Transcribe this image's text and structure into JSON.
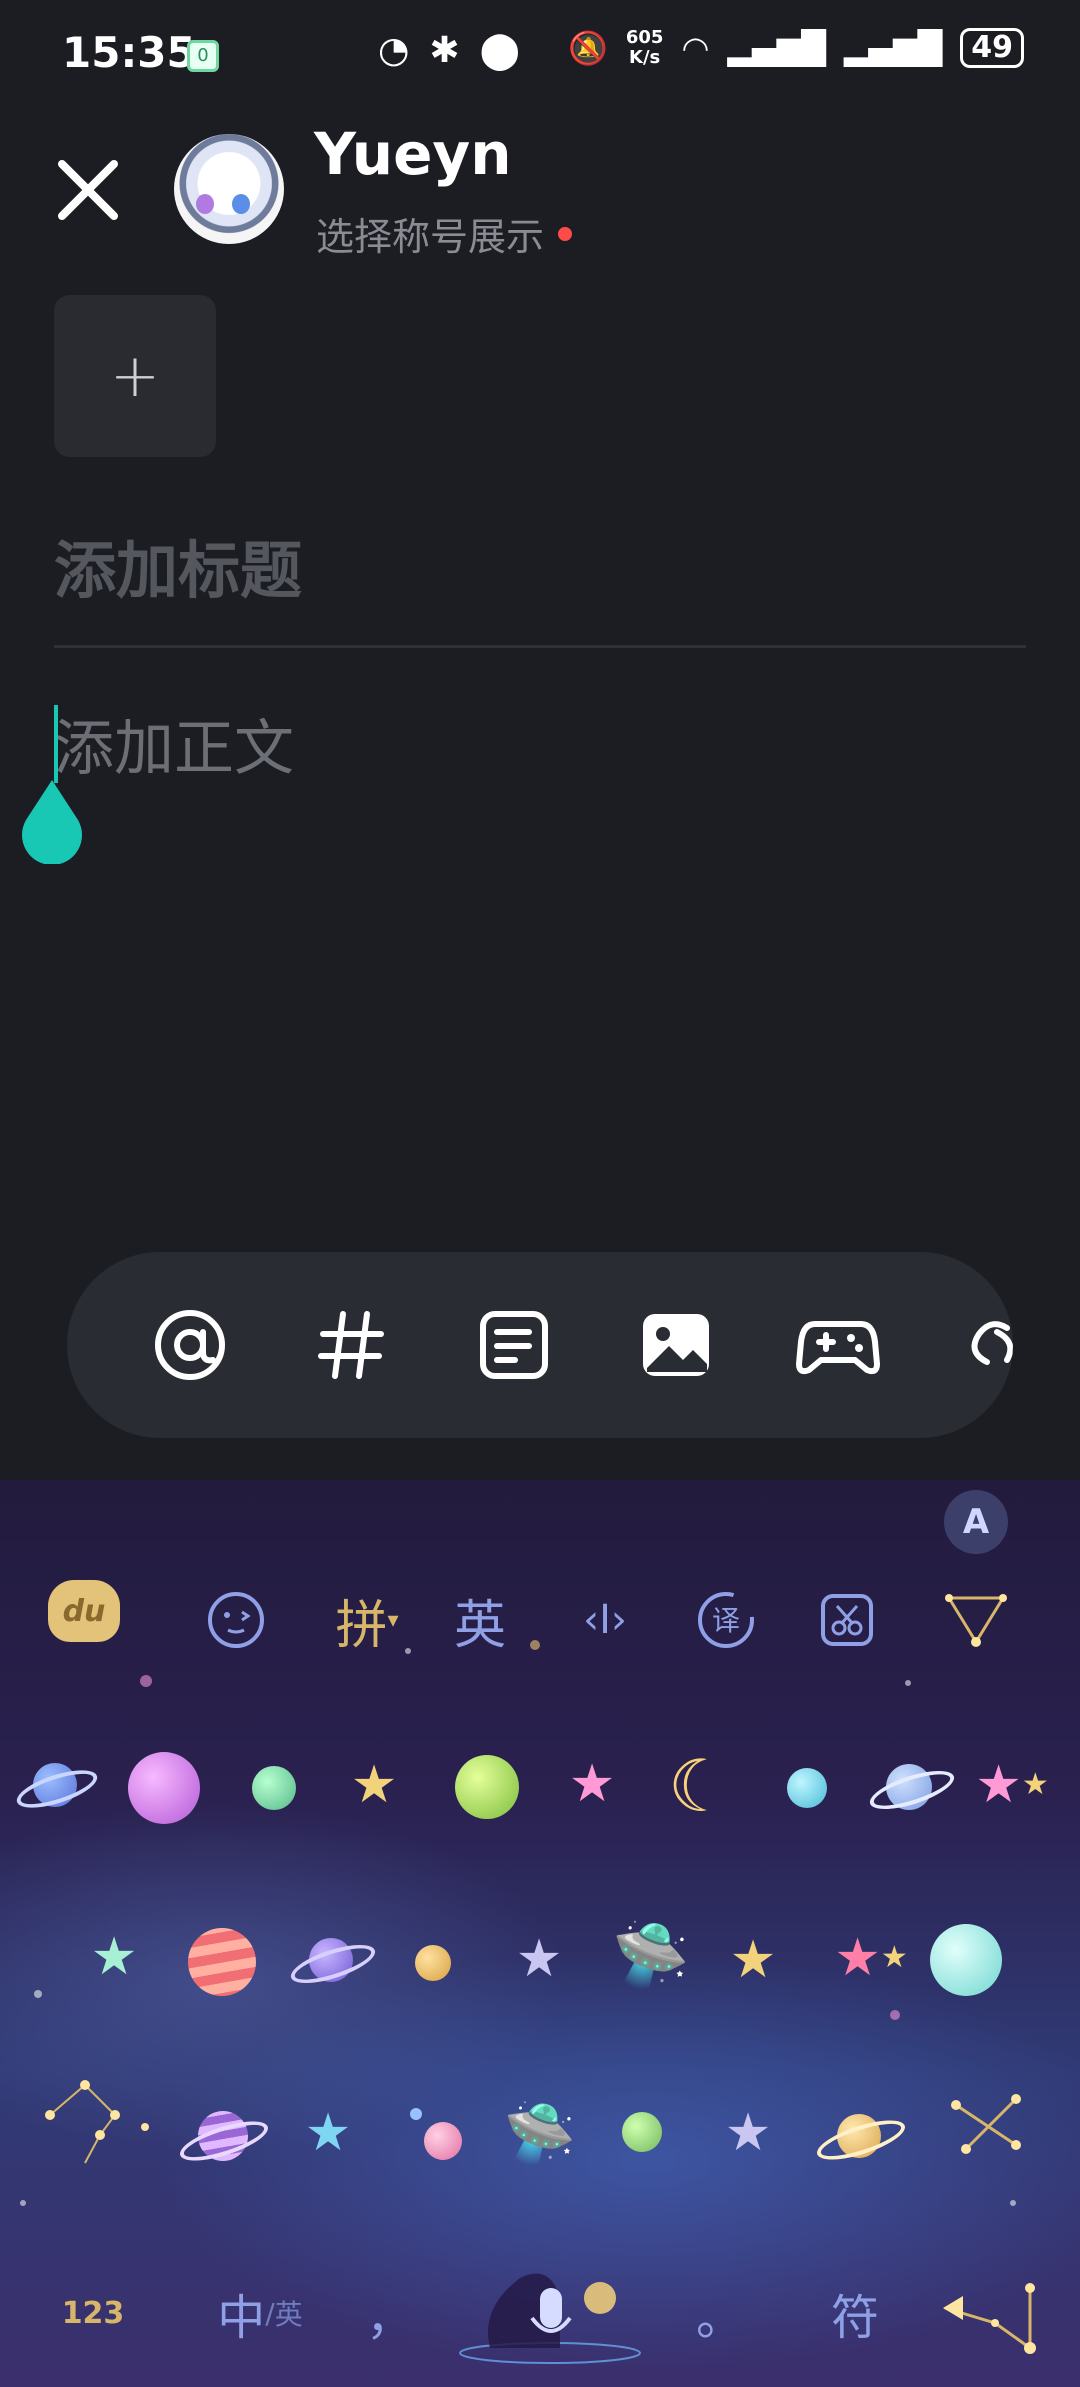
{
  "status_bar": {
    "time": "15:35",
    "notify_badge": "0",
    "speed_value": "605",
    "speed_unit": "K/s",
    "battery": "49"
  },
  "header": {
    "username": "Yueyn",
    "title_select": "选择称号展示"
  },
  "editor": {
    "add_media": "+",
    "title_placeholder": "添加标题",
    "body_placeholder": "添加正文"
  },
  "toolbar": {
    "tools": [
      "at-icon",
      "hashtag-icon",
      "notes-icon",
      "image-icon",
      "gamepad-icon",
      "link-icon"
    ]
  },
  "keyboard": {
    "brand": "du",
    "pinyin": "拼",
    "english": "英",
    "zhong": "中",
    "ying_small": "英",
    "comma": "，",
    "period": "。",
    "fu": "符",
    "num": "123",
    "a_button": "A",
    "accent": "#d7b66a"
  }
}
